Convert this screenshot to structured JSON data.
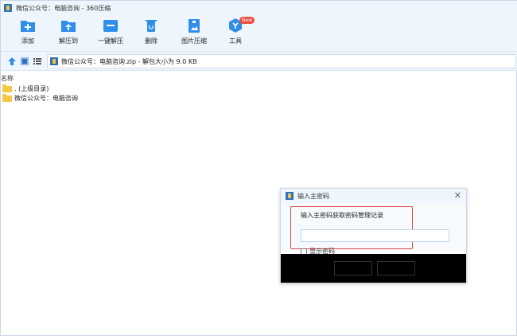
{
  "window": {
    "title": "微信公众号：电脑咨询 - 360压缩"
  },
  "toolbar": {
    "items": [
      {
        "label": "添加",
        "icon": "add-icon"
      },
      {
        "label": "解压到",
        "icon": "extract-to-icon"
      },
      {
        "label": "一键解压",
        "icon": "one-click-extract-icon"
      },
      {
        "label": "删除",
        "icon": "delete-icon"
      },
      {
        "label": "图片压缩",
        "icon": "image-compress-icon"
      },
      {
        "label": "工具",
        "icon": "tools-icon",
        "badge": "New"
      }
    ]
  },
  "addressbar": {
    "path": "微信公众号：电脑咨询.zip - 解包大小为 9.0 KB"
  },
  "filelist": {
    "column_name": "名称",
    "rows": [
      {
        "name": ". (上级目录)"
      },
      {
        "name": "微信公众号：电脑咨询"
      }
    ]
  },
  "dialog": {
    "title": "输入主密码",
    "prompt": "输入主密码获取密码管理记录",
    "password_value": "",
    "show_password_label": "显示密码"
  },
  "colors": {
    "chrome": "#eef5fd",
    "accent": "#2f8ee9",
    "highlight_frame": "#e0484b",
    "folder": "#f6c744"
  }
}
